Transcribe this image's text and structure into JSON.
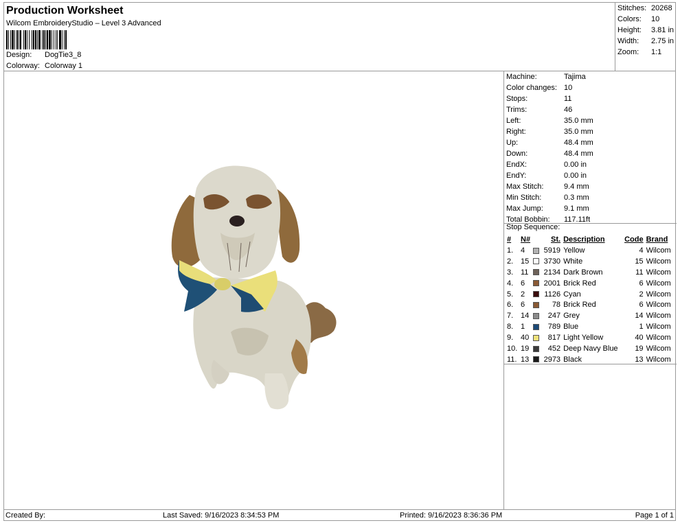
{
  "header": {
    "title": "Production Worksheet",
    "subtitle": "Wilcom EmbroideryStudio – Level 3 Advanced",
    "design_label": "Design:",
    "design_value": "DogTie3_8",
    "colorway_label": "Colorway:",
    "colorway_value": "Colorway 1"
  },
  "stats": [
    {
      "label": "Stitches:",
      "value": "20268"
    },
    {
      "label": "Colors:",
      "value": "10"
    },
    {
      "label": "Height:",
      "value": "3.81 in"
    },
    {
      "label": "Width:",
      "value": "2.75 in"
    },
    {
      "label": "Zoom:",
      "value": "1:1"
    }
  ],
  "info": [
    {
      "label": "Machine:",
      "value": "Tajima"
    },
    {
      "label": "Color changes:",
      "value": "10"
    },
    {
      "label": "Stops:",
      "value": "11"
    },
    {
      "label": "Trims:",
      "value": "46"
    },
    {
      "label": "Left:",
      "value": "35.0 mm"
    },
    {
      "label": "Right:",
      "value": "35.0 mm"
    },
    {
      "label": "Up:",
      "value": "48.4 mm"
    },
    {
      "label": "Down:",
      "value": "48.4 mm"
    },
    {
      "label": "EndX:",
      "value": "0.00 in"
    },
    {
      "label": "EndY:",
      "value": "0.00 in"
    },
    {
      "label": "Max Stitch:",
      "value": "9.4 mm"
    },
    {
      "label": "Min Stitch:",
      "value": "0.3 mm"
    },
    {
      "label": "Max Jump:",
      "value": "9.1 mm"
    },
    {
      "label": "Total Bobbin:",
      "value": "117.11ft"
    }
  ],
  "stop_sequence": {
    "heading": "Stop Sequence:",
    "columns": {
      "idx": "#",
      "needle": "N#",
      "st": "St.",
      "desc": "Description",
      "code": "Code",
      "brand": "Brand"
    },
    "rows": [
      {
        "idx": "1.",
        "needle": "4",
        "color": "#b3b3b3",
        "st": "5919",
        "desc": "Yellow",
        "code": "4",
        "brand": "Wilcom"
      },
      {
        "idx": "2.",
        "needle": "15",
        "color": "#ffffff",
        "st": "3730",
        "desc": "White",
        "code": "15",
        "brand": "Wilcom"
      },
      {
        "idx": "3.",
        "needle": "11",
        "color": "#6e6259",
        "st": "2134",
        "desc": "Dark Brown",
        "code": "11",
        "brand": "Wilcom"
      },
      {
        "idx": "4.",
        "needle": "6",
        "color": "#8a5a35",
        "st": "2001",
        "desc": "Brick Red",
        "code": "6",
        "brand": "Wilcom"
      },
      {
        "idx": "5.",
        "needle": "2",
        "color": "#3a0c0c",
        "st": "1126",
        "desc": "Cyan",
        "code": "2",
        "brand": "Wilcom"
      },
      {
        "idx": "6.",
        "needle": "6",
        "color": "#8a5a35",
        "st": "78",
        "desc": "Brick Red",
        "code": "6",
        "brand": "Wilcom"
      },
      {
        "idx": "7.",
        "needle": "14",
        "color": "#8c8c8c",
        "st": "247",
        "desc": "Grey",
        "code": "14",
        "brand": "Wilcom"
      },
      {
        "idx": "8.",
        "needle": "1",
        "color": "#1c4a78",
        "st": "789",
        "desc": "Blue",
        "code": "1",
        "brand": "Wilcom"
      },
      {
        "idx": "9.",
        "needle": "40",
        "color": "#f0e27a",
        "st": "817",
        "desc": "Light Yellow",
        "code": "40",
        "brand": "Wilcom"
      },
      {
        "idx": "10.",
        "needle": "19",
        "color": "#3a3a3a",
        "st": "452",
        "desc": "Deep Navy Blue",
        "code": "19",
        "brand": "Wilcom"
      },
      {
        "idx": "11.",
        "needle": "13",
        "color": "#1a1a1a",
        "st": "2973",
        "desc": "Black",
        "code": "13",
        "brand": "Wilcom"
      }
    ]
  },
  "footer": {
    "created_by": "Created By:",
    "last_saved": "Last Saved: 9/16/2023 8:34:53 PM",
    "printed": "Printed: 9/16/2023 8:36:36 PM",
    "page": "Page 1 of 1"
  }
}
